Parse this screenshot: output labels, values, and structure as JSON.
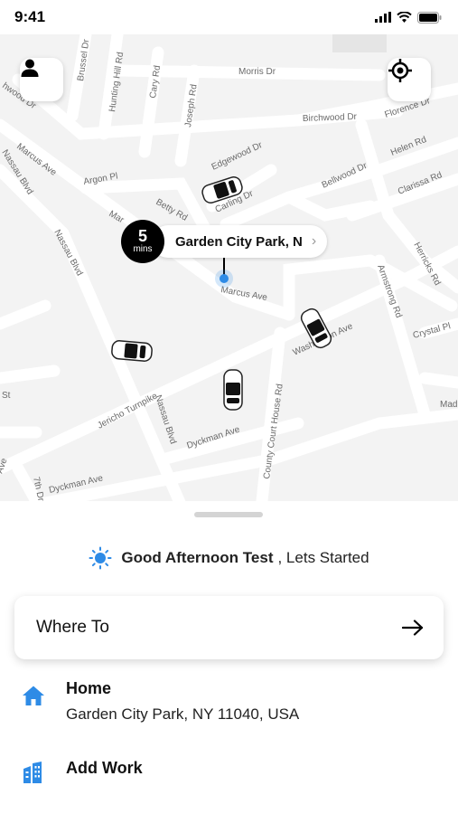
{
  "status_bar": {
    "time": "9:41"
  },
  "map": {
    "streets": [
      "Brussel Dr",
      "Hunting Hill Rd",
      "Cary Rd",
      "Joseph Rd",
      "Morris Dr",
      "Birchwood Dr",
      "Florence Dr",
      "Marcus Ave",
      "Nassau Blvd",
      "Argon Pl",
      "Edgewood Dr",
      "Carling Dr",
      "Betty Rd",
      "Bellwood Dr",
      "Helen Rd",
      "Clarissa Rd",
      "Herricks Rd",
      "Armstrong Rd",
      "Crystal Pl",
      "Washington Ave",
      "Jericho Turnpike",
      "Dyckman Ave",
      "County Court House Rd",
      "7th Dr",
      "Mad",
      "Ave",
      "St",
      "Mar",
      "hwood Dr"
    ],
    "eta": {
      "minutes": "5",
      "unit": "mins",
      "location": "Garden City Park, N"
    }
  },
  "greeting": {
    "bold": "Good Afternoon Test",
    "rest": ", Lets Started"
  },
  "where_to": {
    "label": "Where To"
  },
  "places": {
    "home": {
      "title": "Home",
      "address": "Garden City Park, NY 11040, USA"
    },
    "work": {
      "title": "Add Work"
    }
  },
  "icons": {
    "profile": "person-icon",
    "locate": "crosshair-icon",
    "weather": "sun-icon",
    "arrow": "arrow-right-icon",
    "home": "house-icon",
    "work": "building-icon"
  },
  "colors": {
    "accent": "#2e8be6",
    "map_bg": "#f3f3f3",
    "road": "#ffffff",
    "pin": "#000000"
  }
}
